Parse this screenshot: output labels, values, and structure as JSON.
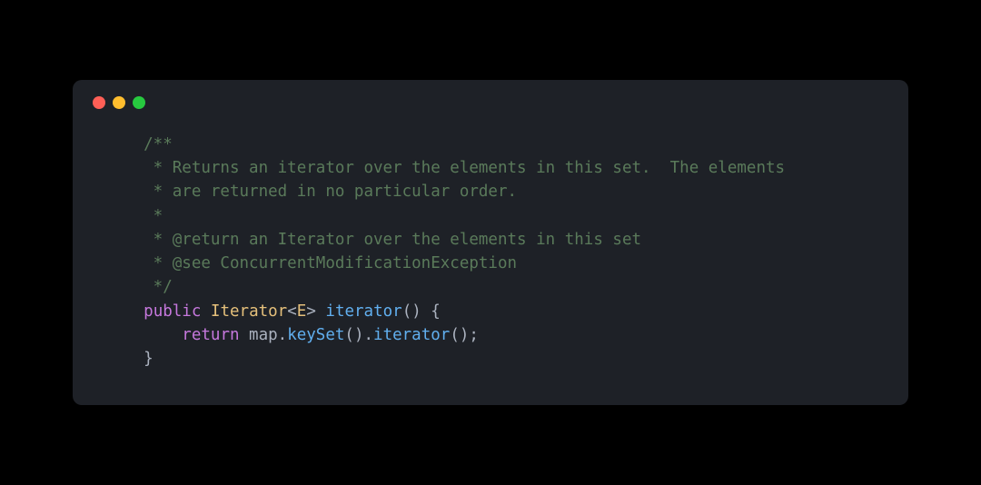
{
  "window": {
    "traffic_lights": {
      "red": "#ff5f56",
      "yellow": "#ffbd2e",
      "green": "#27c93f"
    }
  },
  "code": {
    "l1": "    /**",
    "l2": "     * Returns an iterator over the elements in this set.  The elements",
    "l3": "     * are returned in no particular order.",
    "l4": "     *",
    "l5": "     * @return an Iterator over the elements in this set",
    "l6": "     * @see ConcurrentModificationException",
    "l7": "     */",
    "l8a": "    ",
    "l8b": "public",
    "l8c": " ",
    "l8d": "Iterator",
    "l8e": "<",
    "l8f": "E",
    "l8g": ">",
    "l8h": " ",
    "l8i": "iterator",
    "l8j": "() {",
    "l9a": "        ",
    "l9b": "return",
    "l9c": " map.",
    "l9d": "keySet",
    "l9e": "().",
    "l9f": "iterator",
    "l9g": "();",
    "l10": "    }"
  }
}
